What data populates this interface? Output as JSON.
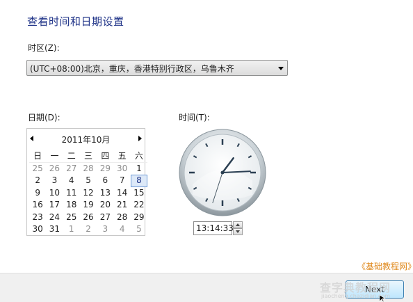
{
  "page_title": "查看时间和日期设置",
  "timezone": {
    "label": "时区(Z):",
    "value": "(UTC+08:00)北京，重庆，香港特别行政区，乌鲁木齐"
  },
  "date": {
    "label": "日期(D):",
    "month_title": "2011年10月",
    "weekdays": [
      "日",
      "一",
      "二",
      "三",
      "四",
      "五",
      "六"
    ],
    "weeks": [
      [
        "25",
        "26",
        "27",
        "28",
        "29",
        "30",
        "1"
      ],
      [
        "2",
        "3",
        "4",
        "5",
        "6",
        "7",
        "8"
      ],
      [
        "9",
        "10",
        "11",
        "12",
        "13",
        "14",
        "15"
      ],
      [
        "16",
        "17",
        "18",
        "19",
        "20",
        "21",
        "22"
      ],
      [
        "23",
        "24",
        "25",
        "26",
        "27",
        "28",
        "29"
      ],
      [
        "30",
        "31",
        "1",
        "2",
        "3",
        "4",
        "5"
      ]
    ],
    "selected_day": "8"
  },
  "time": {
    "label": "时间(T):",
    "value": "13:14:33",
    "hour": 13,
    "minute": 14,
    "second": 33
  },
  "watermark": {
    "link_text": "《基础教程网》",
    "stamp_text": "查字典教程网",
    "stamp_sub": "jiaocheng.chazidian.com"
  },
  "footer": {
    "next_label": "Next"
  },
  "colors": {
    "title": "#1e3287",
    "watermark": "#e08a1e",
    "selected_day_bg": "#dde9f8"
  }
}
